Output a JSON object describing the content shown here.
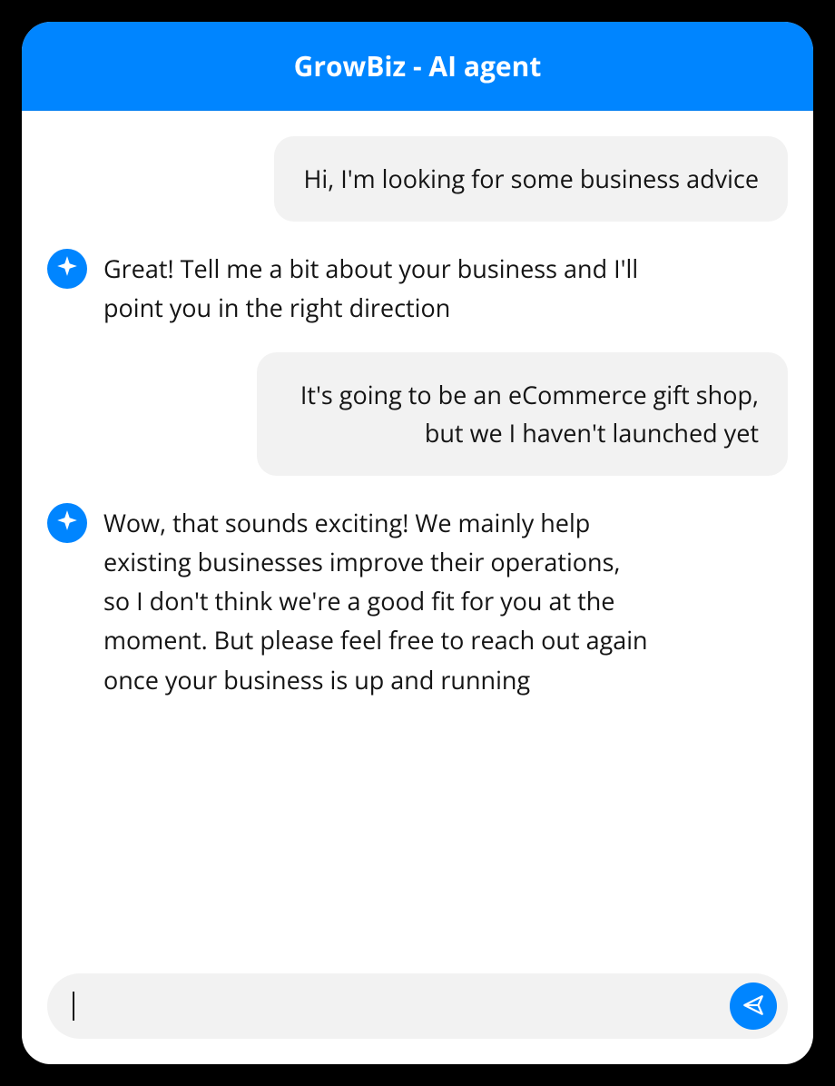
{
  "header": {
    "title": "GrowBiz - AI agent"
  },
  "messages": {
    "m0": {
      "role": "user",
      "text": "Hi, I'm looking for some business advice"
    },
    "m1": {
      "role": "agent",
      "text": "Great! Tell me a bit about your business and I'll point you in the right direction"
    },
    "m2": {
      "role": "user",
      "text": "It's going to be an eCommerce gift shop, but we I haven't launched yet"
    },
    "m3": {
      "role": "agent",
      "text": "Wow, that sounds exciting! We mainly help existing businesses improve their operations, so I don't think we're a good fit for you at the moment. But please feel free to reach out again once your business is up and running"
    }
  },
  "input": {
    "value": "",
    "placeholder": ""
  },
  "colors": {
    "accent": "#0085ff",
    "bubble": "#f2f2f2"
  },
  "icons": {
    "agent": "sparkle-icon",
    "send": "send-icon"
  }
}
